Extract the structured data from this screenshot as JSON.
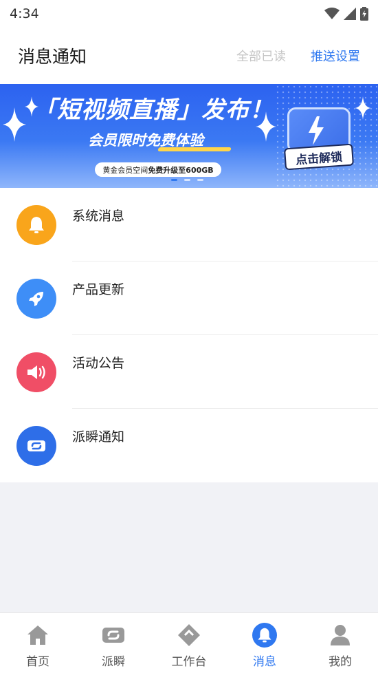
{
  "status_bar": {
    "time": "4:34",
    "icons": [
      "wifi-icon",
      "signal-icon",
      "battery-charging-icon"
    ]
  },
  "header": {
    "title": "消息通知",
    "mark_all_read": "全部已读",
    "push_settings": "推送设置",
    "accent_color": "#2f78f0"
  },
  "banner": {
    "bracket_left": "「",
    "headline": "短视频直播",
    "bracket_right": "」",
    "headline_suffix": "发布！",
    "sub_prefix": "会员",
    "sub_emphasis": "限时免费",
    "sub_suffix": "体验",
    "pill_prefix": "黄金会员空间",
    "pill_bold": "免费升级至600GB",
    "cta": "点击解锁",
    "slide_count": 3,
    "active_slide": 1
  },
  "messages": [
    {
      "title": "系统消息",
      "icon": "bell-icon",
      "color": "#f9a51b"
    },
    {
      "title": "产品更新",
      "icon": "rocket-icon",
      "color": "#3e8ef7"
    },
    {
      "title": "活动公告",
      "icon": "speaker-icon",
      "color": "#f04e66"
    },
    {
      "title": "派瞬通知",
      "icon": "paishun-icon",
      "color": "#2e6ee8"
    }
  ],
  "bottom_nav": {
    "items": [
      {
        "label": "首页",
        "icon": "home-icon",
        "active": false
      },
      {
        "label": "派瞬",
        "icon": "paishun-icon",
        "active": false
      },
      {
        "label": "工作台",
        "icon": "workbench-icon",
        "active": false
      },
      {
        "label": "消息",
        "icon": "bell-icon",
        "active": true
      },
      {
        "label": "我的",
        "icon": "user-icon",
        "active": false
      }
    ],
    "inactive_color": "#999999",
    "active_color": "#2f78f0"
  }
}
